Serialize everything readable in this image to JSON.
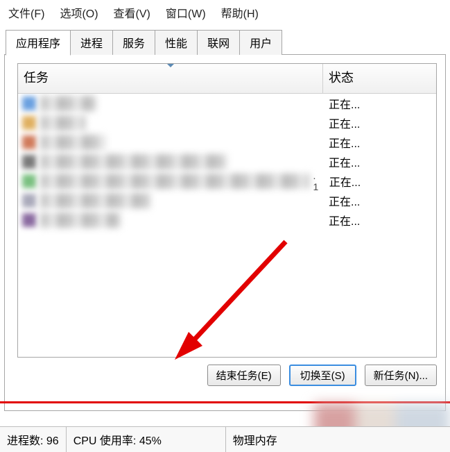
{
  "menu": {
    "file": "文件(F)",
    "options": "选项(O)",
    "view": "查看(V)",
    "windows": "窗口(W)",
    "help": "帮助(H)"
  },
  "tabs": {
    "applications": "应用程序",
    "processes": "进程",
    "services": "服务",
    "performance": "性能",
    "networking": "联网",
    "users": "用户"
  },
  "columns": {
    "task": "任务",
    "status": "状态"
  },
  "status_value": "正在...",
  "row_count": 7,
  "buttons": {
    "end_task": "结束任务(E)",
    "switch_to": "切换至(S)",
    "new_task": "新任务(N)..."
  },
  "statusbar": {
    "process_count_label": "进程数:",
    "process_count": "96",
    "cpu_label": "CPU 使用率:",
    "cpu_value": "45%",
    "mem_label": "物理内存"
  }
}
